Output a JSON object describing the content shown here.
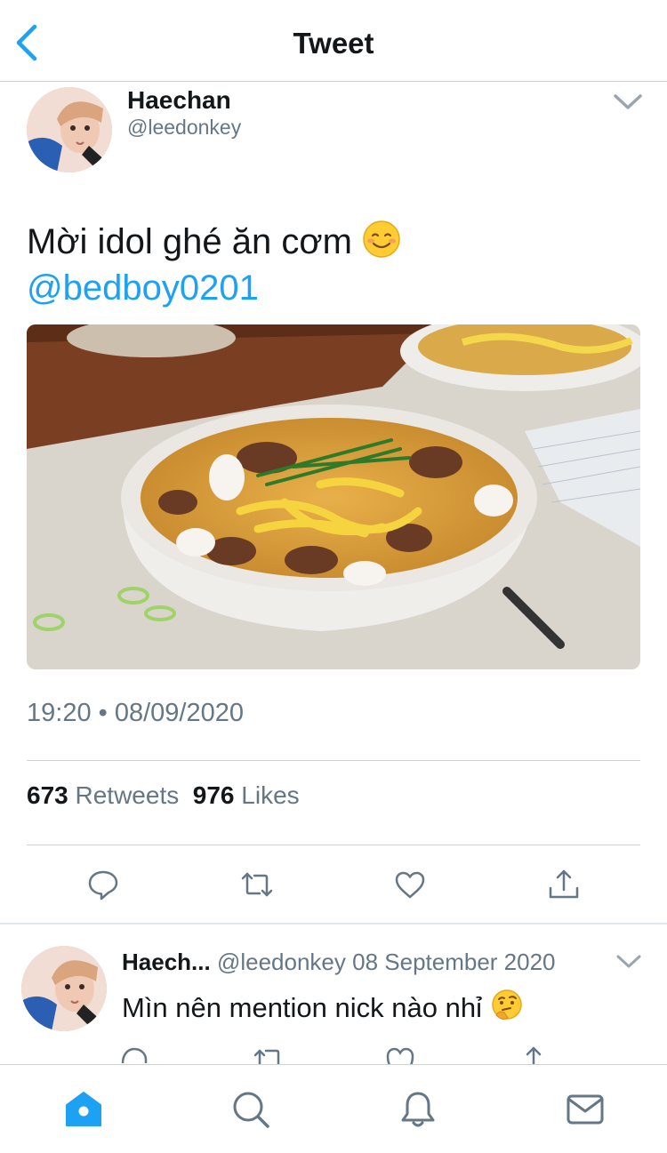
{
  "header": {
    "title": "Tweet"
  },
  "tweet": {
    "author_name": "Haechan",
    "author_handle": "@leedonkey",
    "text": "Mời idol ghé ăn cơm",
    "text_emoji": "smiling-face-icon",
    "mention": "@bedboy0201",
    "image": "bowl-of-noodle-soup-photo",
    "timestamp": "19:20 • 08/09/2020",
    "retweets_count": "673",
    "retweets_label": "Retweets",
    "likes_count": "976",
    "likes_label": "Likes"
  },
  "actions": [
    "reply-icon",
    "retweet-icon",
    "like-icon",
    "share-icon"
  ],
  "reply": {
    "author_name": "Haech...",
    "author_handle": "@leedonkey",
    "date": "08 September 2020",
    "text": "Mìn nên mention nick nào nhỉ",
    "text_emoji": "thinking-face-icon"
  },
  "tabbar": {
    "items": [
      "home-icon",
      "search-icon",
      "notifications-icon",
      "messages-icon"
    ],
    "active": "home-icon"
  },
  "colors": {
    "accent": "#1da1f2",
    "text": "#14171a",
    "secondary": "#657786",
    "divider": "#cfd3d6"
  }
}
